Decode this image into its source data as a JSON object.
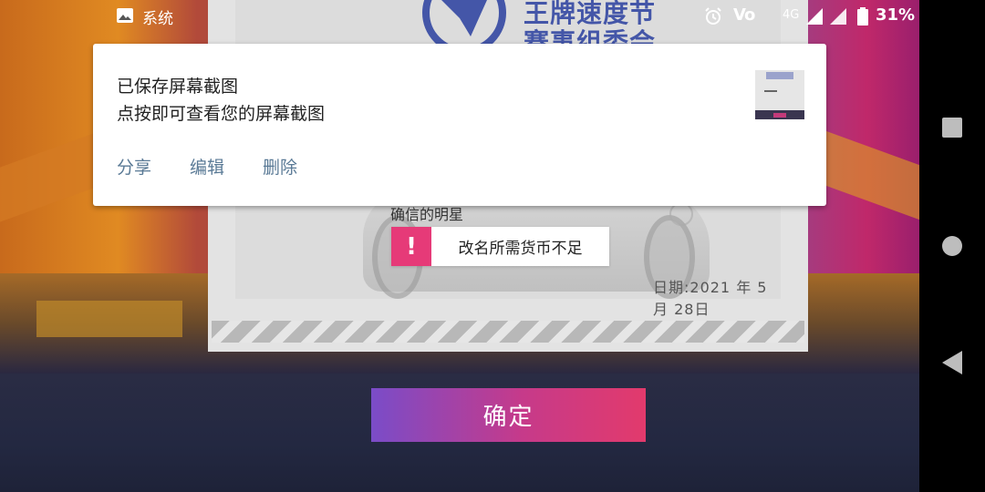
{
  "status_bar": {
    "app_name": "系统",
    "network": "4G",
    "volte": "Vo",
    "battery": "31%"
  },
  "game": {
    "logo_line1": "王牌速度节",
    "logo_line2": "赛事组委会",
    "star_text": "确信的明星",
    "date": "日期:2021 年  5月  28日",
    "toast_mark": "!",
    "toast_message": "改名所需货币不足",
    "confirm_label": "确定"
  },
  "notification": {
    "title": "已保存屏幕截图",
    "body": "点按即可查看您的屏幕截图",
    "actions": [
      "分享",
      "编辑",
      "删除"
    ]
  },
  "colors": {
    "accent_pink": "#e63a78",
    "button_start": "#7a4cc8",
    "button_end": "#e23a6c",
    "action_text": "#5a7a96"
  },
  "icons": {
    "status": [
      "image-icon",
      "alarm-icon",
      "signal-icon",
      "battery-icon"
    ],
    "nav": [
      "recents-icon",
      "home-icon",
      "back-icon"
    ]
  }
}
